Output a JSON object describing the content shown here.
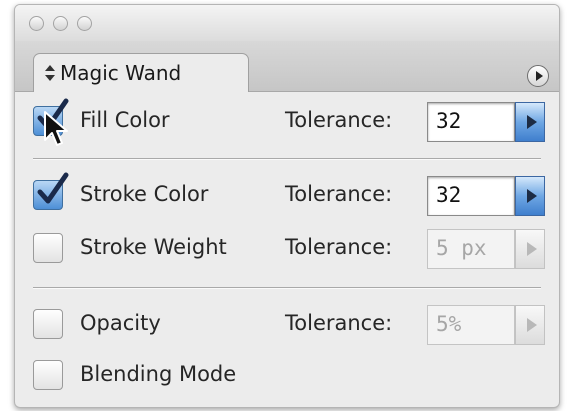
{
  "panel": {
    "tab_title": "Magic Wand"
  },
  "rows": [
    {
      "label": "Fill Color",
      "checked": true,
      "tolerance_label": "Tolerance:",
      "value": "32",
      "enabled": true
    },
    {
      "label": "Stroke Color",
      "checked": true,
      "tolerance_label": "Tolerance:",
      "value": "32",
      "enabled": true
    },
    {
      "label": "Stroke Weight",
      "checked": false,
      "tolerance_label": "Tolerance:",
      "value": "5 px",
      "enabled": false
    },
    {
      "label": "Opacity",
      "checked": false,
      "tolerance_label": "Tolerance:",
      "value": "5%",
      "enabled": false
    },
    {
      "label": "Blending Mode",
      "checked": false
    }
  ],
  "colors": {
    "checkbox_checked": "#4d8fd6",
    "stepper_active": "#3f7fcd",
    "panel_bg": "#ececec"
  }
}
